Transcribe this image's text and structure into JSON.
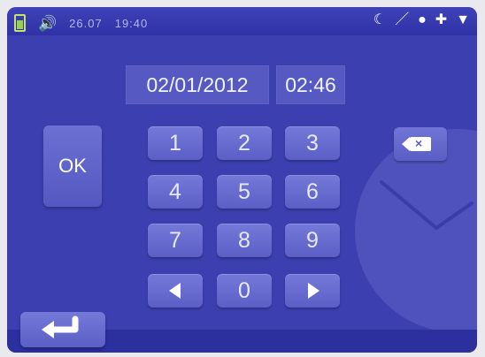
{
  "status": {
    "date": "26.07",
    "time": "19:40",
    "icons": [
      "battery-icon",
      "speaker-icon",
      "moon-icon",
      "pencil-icon",
      "person-icon",
      "plus-icon",
      "shield-icon"
    ]
  },
  "datetime": {
    "date": "02/01/2012",
    "time": "02:46"
  },
  "buttons": {
    "ok": "OK"
  },
  "keypad": {
    "keys": [
      "1",
      "2",
      "3",
      "4",
      "5",
      "6",
      "7",
      "8",
      "9",
      "0"
    ]
  },
  "colors": {
    "background": "#3c3fb0",
    "key": "#6a6ed2"
  }
}
